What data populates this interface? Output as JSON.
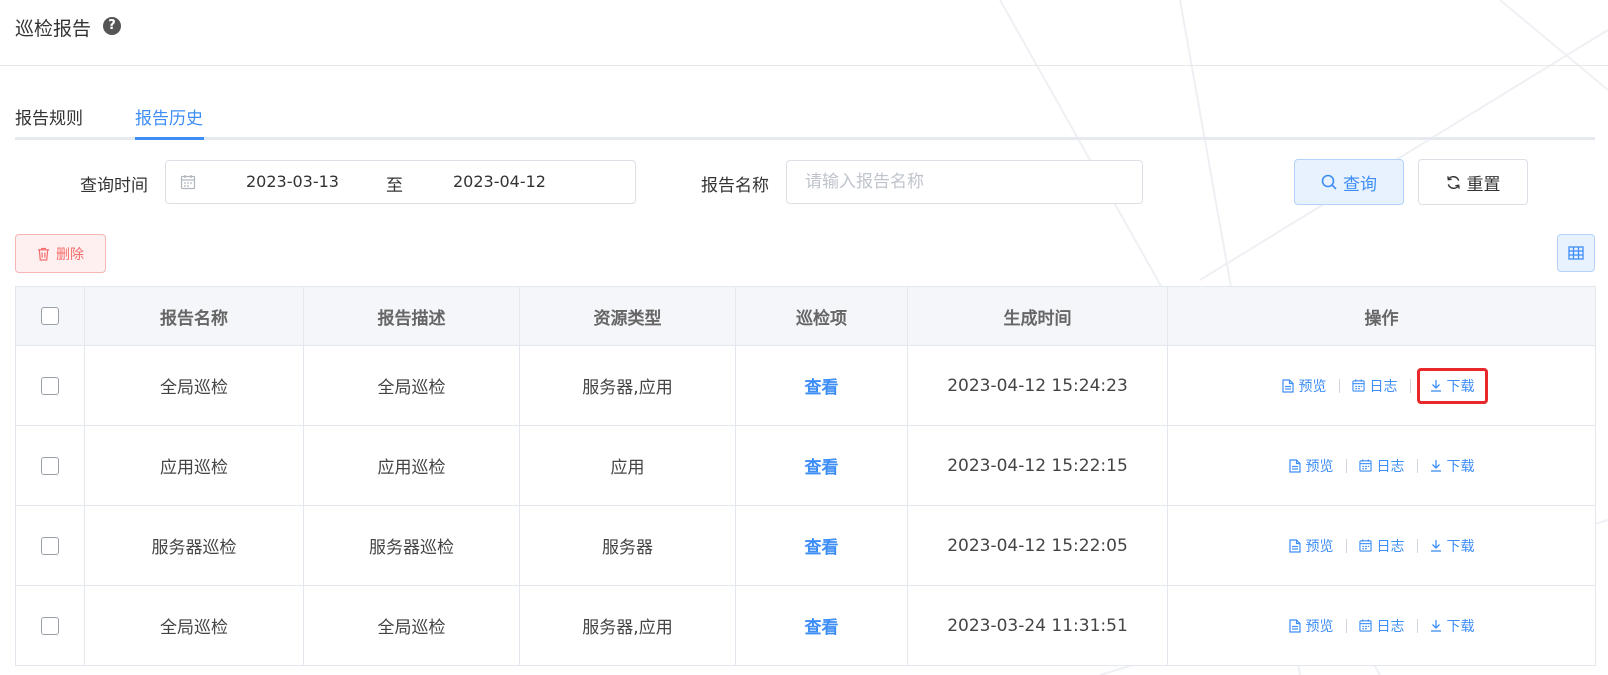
{
  "header": {
    "title": "巡检报告",
    "help_icon": "question-circle-icon"
  },
  "tabs": [
    {
      "label": "报告规则",
      "active": false
    },
    {
      "label": "报告历史",
      "active": true
    }
  ],
  "filters": {
    "time_label": "查询时间",
    "start_date": "2023-03-13",
    "separator": "至",
    "end_date": "2023-04-12",
    "name_label": "报告名称",
    "name_placeholder": "请输入报告名称",
    "name_value": ""
  },
  "buttons": {
    "query": "查询",
    "reset": "重置",
    "delete": "删除"
  },
  "table": {
    "columns": [
      "报告名称",
      "报告描述",
      "资源类型",
      "巡检项",
      "生成时间",
      "操作"
    ],
    "view_label": "查看",
    "actions": {
      "preview": "预览",
      "log": "日志",
      "download": "下载"
    },
    "rows": [
      {
        "name": "全局巡检",
        "desc": "全局巡检",
        "type": "服务器,应用",
        "time": "2023-04-12 15:24:23"
      },
      {
        "name": "应用巡检",
        "desc": "应用巡检",
        "type": "应用",
        "time": "2023-04-12 15:22:15"
      },
      {
        "name": "服务器巡检",
        "desc": "服务器巡检",
        "type": "服务器",
        "time": "2023-04-12 15:22:05"
      },
      {
        "name": "全局巡检",
        "desc": "全局巡检",
        "type": "服务器,应用",
        "time": "2023-03-24 11:31:51"
      }
    ]
  },
  "colors": {
    "accent": "#3e8ef7",
    "danger": "#f56c6c",
    "highlight": "#e8282a"
  }
}
